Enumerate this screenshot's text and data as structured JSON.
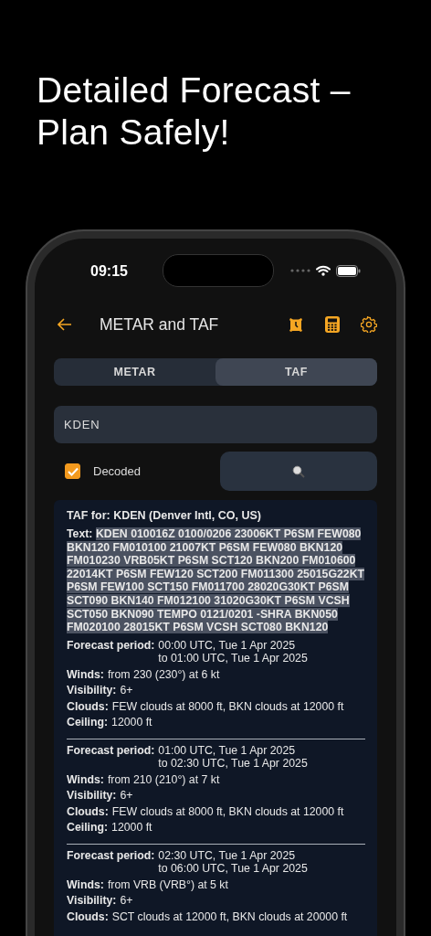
{
  "headline": "Detailed Forecast – Plan Safely!",
  "status_bar": {
    "time": "09:15"
  },
  "nav": {
    "title": "METAR and TAF"
  },
  "tabs": [
    {
      "label": "METAR",
      "selected": false
    },
    {
      "label": "TAF",
      "selected": true
    }
  ],
  "station_field": {
    "value": "KDEN"
  },
  "decoded": {
    "label": "Decoded",
    "checked": true
  },
  "report": {
    "heading": "TAF for: KDEN (Denver Intl, CO, US)",
    "text_label": "Text:",
    "raw": "KDEN 010016Z 0100/0206 23006KT P6SM FEW080 BKN120 FM010100 21007KT P6SM FEW080 BKN120 FM010230 VRB05KT P6SM SCT120 BKN200 FM010600 22014KT P6SM FEW120 SCT200 FM011300 25015G22KT P6SM FEW100 SCT150 FM011700 28020G30KT P6SM SCT090 BKN140 FM012100 31020G30KT P6SM VCSH SCT050 BKN090 TEMPO 0121/0201 -SHRA BKN050 FM020100 28015KT P6SM VCSH SCT080 BKN120",
    "periods": [
      {
        "rows": [
          {
            "label": "Forecast period:",
            "lines": [
              "00:00 UTC, Tue 1 Apr 2025",
              "to 01:00 UTC, Tue 1 Apr 2025"
            ]
          },
          {
            "label": "Winds:",
            "lines": [
              "from 230 (230°) at 6 kt"
            ]
          },
          {
            "label": "Visibility:",
            "lines": [
              "6+"
            ]
          },
          {
            "label": "Clouds:",
            "lines": [
              "FEW clouds at 8000 ft, BKN clouds at 12000 ft"
            ]
          },
          {
            "label": "Ceiling:",
            "lines": [
              "12000 ft"
            ]
          }
        ]
      },
      {
        "rows": [
          {
            "label": "Forecast period:",
            "lines": [
              "01:00 UTC, Tue 1 Apr 2025",
              "to 02:30 UTC, Tue 1 Apr 2025"
            ]
          },
          {
            "label": "Winds:",
            "lines": [
              "from 210 (210°) at 7 kt"
            ]
          },
          {
            "label": "Visibility:",
            "lines": [
              "6+"
            ]
          },
          {
            "label": "Clouds:",
            "lines": [
              "FEW clouds at 8000 ft, BKN clouds at 12000 ft"
            ]
          },
          {
            "label": "Ceiling:",
            "lines": [
              "12000 ft"
            ]
          }
        ]
      },
      {
        "rows": [
          {
            "label": "Forecast period:",
            "lines": [
              "02:30 UTC, Tue 1 Apr 2025",
              "to 06:00 UTC, Tue 1 Apr 2025"
            ]
          },
          {
            "label": "Winds:",
            "lines": [
              "from VRB (VRB°) at 5 kt"
            ]
          },
          {
            "label": "Visibility:",
            "lines": [
              "6+"
            ]
          },
          {
            "label": "Clouds:",
            "lines": [
              "SCT clouds at 12000 ft, BKN clouds at 20000 ft"
            ]
          }
        ]
      }
    ]
  }
}
